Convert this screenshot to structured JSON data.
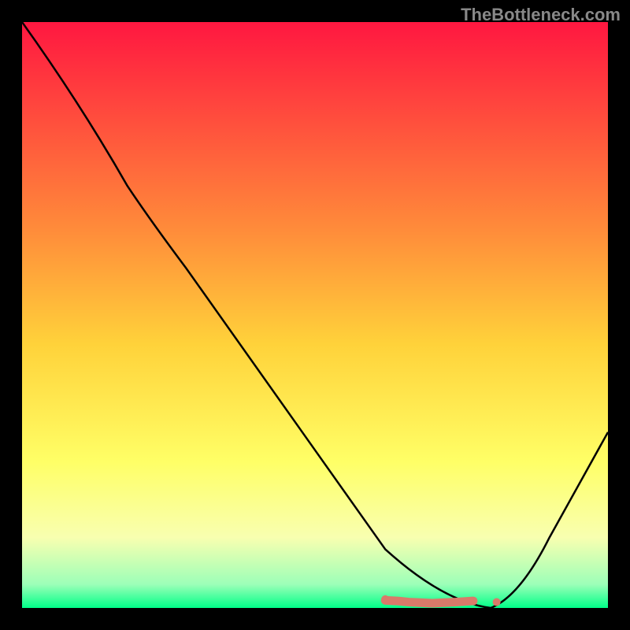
{
  "watermark": "TheBottleneck.com",
  "chart_data": {
    "type": "line",
    "title": "",
    "xlabel": "",
    "ylabel": "",
    "xlim": [
      0,
      100
    ],
    "ylim": [
      0,
      100
    ],
    "gradient_stops": [
      {
        "offset": 0,
        "color": "#ff1740"
      },
      {
        "offset": 35,
        "color": "#ff8a3a"
      },
      {
        "offset": 55,
        "color": "#ffd23a"
      },
      {
        "offset": 75,
        "color": "#ffff66"
      },
      {
        "offset": 88,
        "color": "#f8ffb0"
      },
      {
        "offset": 96,
        "color": "#9cffb8"
      },
      {
        "offset": 100,
        "color": "#00ff88"
      }
    ],
    "curve": [
      {
        "x": 0,
        "y": 100
      },
      {
        "x": 18,
        "y": 72
      },
      {
        "x": 22,
        "y": 66
      },
      {
        "x": 62,
        "y": 10
      },
      {
        "x": 72,
        "y": 1
      },
      {
        "x": 80,
        "y": 0
      },
      {
        "x": 85,
        "y": 2
      },
      {
        "x": 100,
        "y": 30
      }
    ],
    "markers": [
      {
        "x": 62,
        "y": 1.5
      },
      {
        "x": 64,
        "y": 1.2
      },
      {
        "x": 66,
        "y": 1.0
      },
      {
        "x": 68,
        "y": 0.9
      },
      {
        "x": 70,
        "y": 0.8
      },
      {
        "x": 72,
        "y": 0.9
      },
      {
        "x": 74,
        "y": 1.0
      },
      {
        "x": 77,
        "y": 1.2
      },
      {
        "x": 81,
        "y": 1.0
      }
    ]
  }
}
